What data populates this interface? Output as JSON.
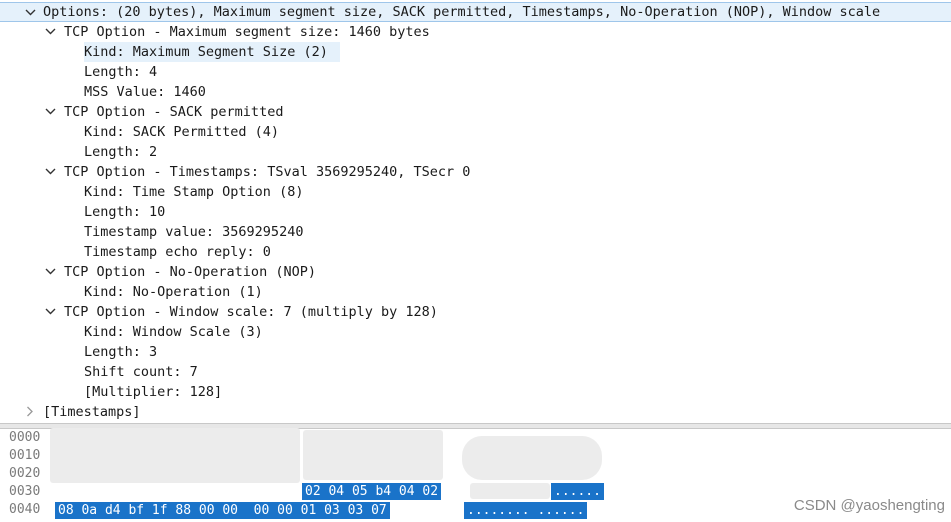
{
  "tree": {
    "rows": [
      {
        "text": "Options: (20 bytes), Maximum segment size, SACK permitted, Timestamps, No-Operation (NOP), Window scale",
        "expanded": true
      },
      {
        "text": "TCP Option - Maximum segment size: 1460 bytes",
        "expanded": true
      },
      {
        "text": "Kind: Maximum Segment Size (2)"
      },
      {
        "text": "Length: 4"
      },
      {
        "text": "MSS Value: 1460"
      },
      {
        "text": "TCP Option - SACK permitted",
        "expanded": true
      },
      {
        "text": "Kind: SACK Permitted (4)"
      },
      {
        "text": "Length: 2"
      },
      {
        "text": "TCP Option - Timestamps: TSval 3569295240, TSecr 0",
        "expanded": true
      },
      {
        "text": "Kind: Time Stamp Option (8)"
      },
      {
        "text": "Length: 10"
      },
      {
        "text": "Timestamp value: 3569295240"
      },
      {
        "text": "Timestamp echo reply: 0"
      },
      {
        "text": "TCP Option - No-Operation (NOP)",
        "expanded": true
      },
      {
        "text": "Kind: No-Operation (1)"
      },
      {
        "text": "TCP Option - Window scale: 7 (multiply by 128)",
        "expanded": true
      },
      {
        "text": "Kind: Window Scale (3)"
      },
      {
        "text": "Length: 3"
      },
      {
        "text": "Shift count: 7"
      },
      {
        "text": "[Multiplier: 128]"
      },
      {
        "text": "[Timestamps]",
        "expanded": false
      }
    ]
  },
  "hex": {
    "offsets": [
      "0000",
      "0010",
      "0020",
      "0030",
      "0040"
    ],
    "row_0030_selected_bytes": "02 04 05 b4 04 02",
    "row_0030_selected_ascii": "......",
    "row_0040_selected_bytes": "08 0a d4 bf 1f 88 00 00  00 00 01 03 03 07",
    "row_0040_selected_ascii": "........ ......"
  },
  "watermark": "CSDN @yaoshengting",
  "colors": {
    "selection": "#1a73c9",
    "highlight": "#e5f1fb"
  }
}
